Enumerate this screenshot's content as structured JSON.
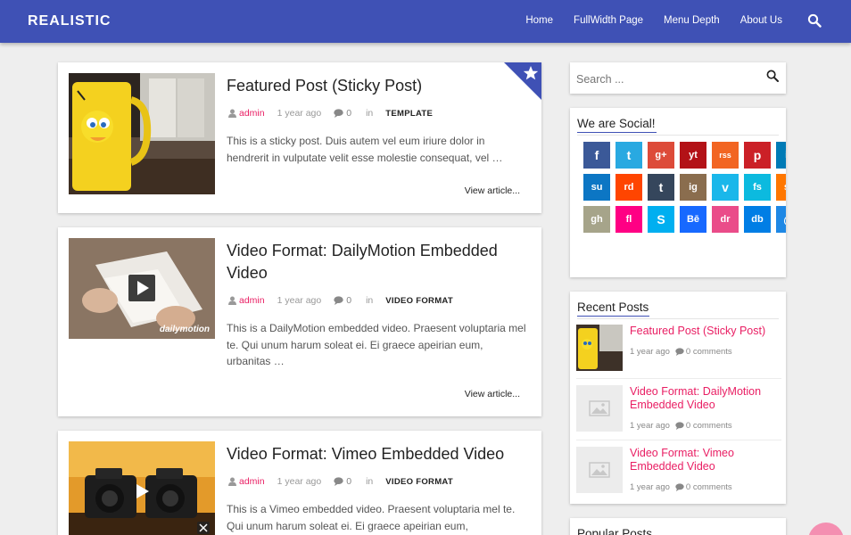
{
  "header": {
    "brand": "REALISTIC",
    "nav": [
      "Home",
      "FullWidth Page",
      "Menu Depth",
      "About Us"
    ]
  },
  "posts": [
    {
      "title": "Featured Post (Sticky Post)",
      "author": "admin",
      "time": "1 year ago",
      "comments": "0",
      "in": "in",
      "category": "TEMPLATE",
      "excerpt": "This is a sticky post. Duis autem vel eum iriure dolor in hendrerit in vulputate velit esse molestie consequat, vel …",
      "read_more": "View article..."
    },
    {
      "title": "Video Format: DailyMotion Embedded Video",
      "author": "admin",
      "time": "1 year ago",
      "comments": "0",
      "in": "in",
      "category": "VIDEO FORMAT",
      "excerpt": "This is a DailyMotion embedded video. Praesent voluptaria mel te. Qui unum harum soleat ei. Ei graece apeirian eum, urbanitas …",
      "read_more": "View article...",
      "watermark": "dailymotion"
    },
    {
      "title": "Video Format: Vimeo Embedded Video",
      "author": "admin",
      "time": "1 year ago",
      "comments": "0",
      "in": "in",
      "category": "VIDEO FORMAT",
      "excerpt": "This is a Vimeo embedded video. Praesent voluptaria mel te. Qui unum harum soleat ei. Ei graece apeirian eum,"
    }
  ],
  "sidebar": {
    "search_placeholder": "Search ...",
    "social_title": "We are Social!",
    "social_icons": [
      {
        "name": "facebook-icon",
        "color": "#3b5998",
        "glyph": "f"
      },
      {
        "name": "twitter-icon",
        "color": "#29a9e1",
        "glyph": "t"
      },
      {
        "name": "google-plus-icon",
        "color": "#dd4b39",
        "glyph": "g+"
      },
      {
        "name": "youtube-icon",
        "color": "#b31217",
        "glyph": "yt"
      },
      {
        "name": "rss-icon",
        "color": "#f26522",
        "glyph": "rss"
      },
      {
        "name": "pinterest-icon",
        "color": "#cb2027",
        "glyph": "p"
      },
      {
        "name": "linkedin-icon",
        "color": "#007bb6",
        "glyph": "in"
      },
      {
        "name": "stumbleupon-icon",
        "color": "#0c76c4",
        "glyph": "su"
      },
      {
        "name": "reddit-icon",
        "color": "#ff4500",
        "glyph": "rd"
      },
      {
        "name": "tumblr-icon",
        "color": "#35465c",
        "glyph": "t"
      },
      {
        "name": "instagram-icon",
        "color": "#8a6d4e",
        "glyph": "ig"
      },
      {
        "name": "vimeo-icon",
        "color": "#1ab7ea",
        "glyph": "v"
      },
      {
        "name": "foursquare-icon",
        "color": "#0cbadf",
        "glyph": "fs"
      },
      {
        "name": "soundcloud-icon",
        "color": "#ff7700",
        "glyph": "sc"
      },
      {
        "name": "github-icon",
        "color": "#a6a48a",
        "glyph": "gh"
      },
      {
        "name": "flickr-icon",
        "color": "#ff0084",
        "glyph": "fl"
      },
      {
        "name": "skype-icon",
        "color": "#00aff0",
        "glyph": "S"
      },
      {
        "name": "behance-icon",
        "color": "#1769ff",
        "glyph": "Bē"
      },
      {
        "name": "dribbble-icon",
        "color": "#ea4c89",
        "glyph": "dr"
      },
      {
        "name": "dropbox-icon",
        "color": "#007ee5",
        "glyph": "db"
      },
      {
        "name": "email-icon",
        "color": "#1e88e5",
        "glyph": "@"
      }
    ],
    "recent_title": "Recent Posts",
    "recent": [
      {
        "title": "Featured Post (Sticky Post)",
        "time": "1 year ago",
        "comments": "0 comments"
      },
      {
        "title": "Video Format: DailyMotion Embedded Video",
        "time": "1 year ago",
        "comments": "0 comments"
      },
      {
        "title": "Video Format: Vimeo Embedded Video",
        "time": "1 year ago",
        "comments": "0 comments"
      }
    ],
    "popular_title": "Popular Posts"
  },
  "colors": {
    "header": "#3f51b5",
    "accent": "#e91e63",
    "background": "#eeeeee"
  }
}
